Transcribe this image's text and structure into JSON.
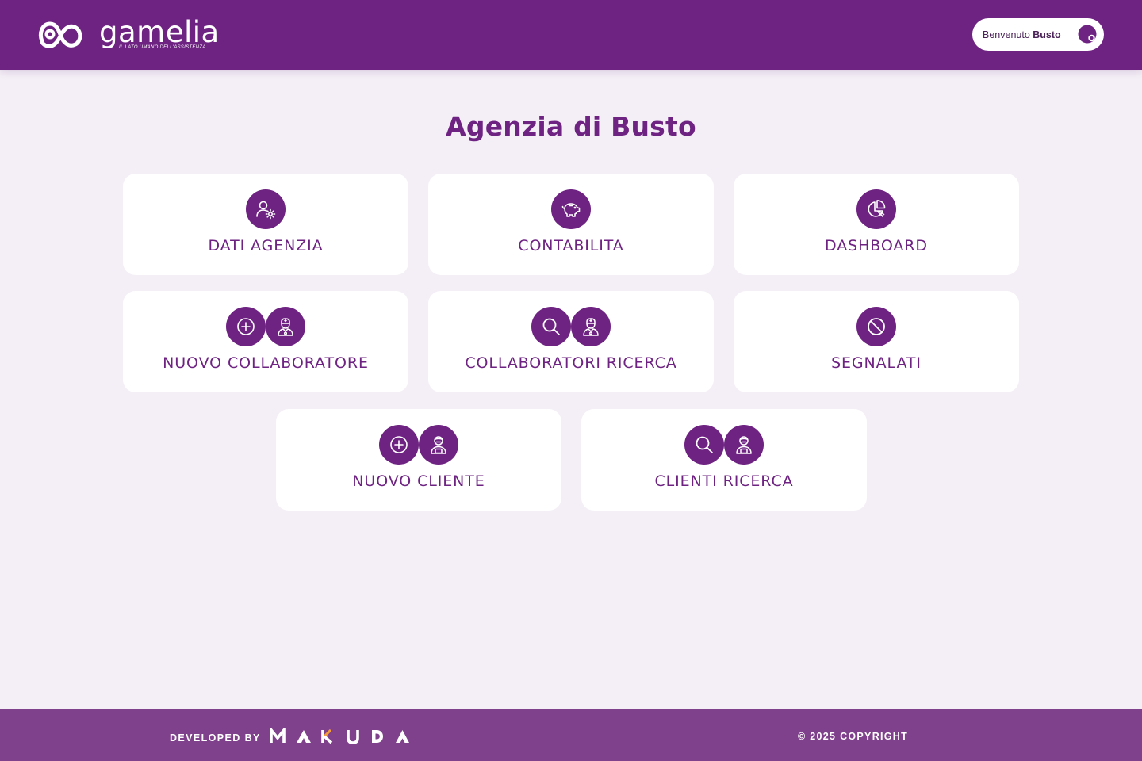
{
  "header": {
    "logo": {
      "word": "gamelia",
      "tagline": "IL LATO UMANO DELL'ASSISTENZA"
    },
    "welcome": {
      "prefix": "Benvenuto",
      "name": "Busto",
      "avatar_icon": "user-avatar-icon"
    }
  },
  "page": {
    "title": "Agenzia di Busto"
  },
  "cards": [
    {
      "label": "DATI AGENZIA",
      "icons": [
        "user-settings-icon"
      ]
    },
    {
      "label": "CONTABILITA",
      "icons": [
        "piggy-bank-icon"
      ]
    },
    {
      "label": "DASHBOARD",
      "icons": [
        "pie-chart-icon"
      ]
    },
    {
      "label": "NUOVO COLLABORATORE",
      "icons": [
        "plus-circle-icon",
        "nurse-icon"
      ]
    },
    {
      "label": "COLLABORATORI RICERCA",
      "icons": [
        "search-icon",
        "nurse-icon"
      ]
    },
    {
      "label": "SEGNALATI",
      "icons": [
        "ban-icon"
      ]
    },
    {
      "label": "NUOVO CLIENTE",
      "icons": [
        "plus-circle-icon",
        "patient-icon"
      ]
    },
    {
      "label": "CLIENTI RICERCA",
      "icons": [
        "search-icon",
        "patient-icon"
      ]
    }
  ],
  "footer": {
    "developed_by": "DEVELOPED BY",
    "developer_logo": "MAKUDA",
    "copyright": "© 2025 COPYRIGHT"
  },
  "colors": {
    "brand_purple": "#6e2382",
    "footer_purple": "#80418c",
    "background": "#f4eff6",
    "card": "#ffffff"
  }
}
